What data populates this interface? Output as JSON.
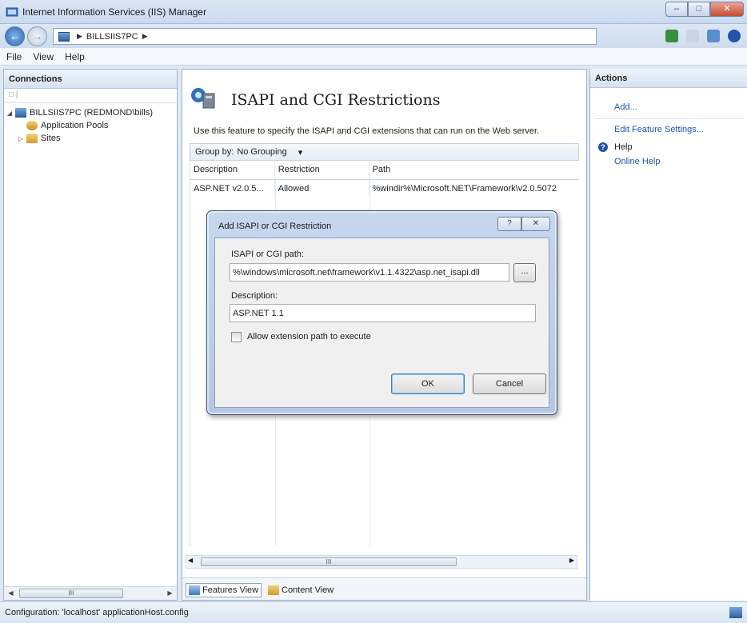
{
  "window": {
    "title": "Internet Information Services (IIS) Manager"
  },
  "address": {
    "segment": "BILLSIIS7PC"
  },
  "menu": [
    "File",
    "View",
    "Help"
  ],
  "connections": {
    "header": "Connections",
    "tree": [
      {
        "label": "BILLSIIS7PC (REDMOND\\bills)"
      },
      {
        "label": "Application Pools"
      },
      {
        "label": "Sites"
      }
    ],
    "scroll_thumb": "III"
  },
  "feature": {
    "title": "ISAPI and CGI Restrictions",
    "description": "Use this feature to specify the ISAPI and CGI extensions that can run on the Web server.",
    "group_by_label": "Group by:",
    "group_by_value": "No Grouping",
    "columns": [
      "Description",
      "Restriction",
      "Path"
    ],
    "rows": [
      {
        "description": "ASP.NET v2.0.5...",
        "restriction": "Allowed",
        "path": "%windir%\\Microsoft.NET\\Framework\\v2.0.5072"
      }
    ],
    "scroll_thumb": "III",
    "tabs": {
      "features_view": "Features View",
      "content_view": "Content View"
    }
  },
  "actions": {
    "header": "Actions",
    "add": "Add...",
    "edit_feature_settings": "Edit Feature Settings...",
    "help_header": "Help",
    "online_help": "Online Help"
  },
  "dialog": {
    "title": "Add ISAPI or CGI Restriction",
    "path_label": "ISAPI or CGI path:",
    "path_value": "%\\windows\\microsoft.net\\framework\\v1.1.4322\\asp.net_isapi.dll",
    "browse_label": "...",
    "description_label": "Description:",
    "description_value": "ASP.NET 1.1",
    "checkbox_label": "Allow extension path to execute",
    "checkbox_checked": false,
    "ok": "OK",
    "cancel": "Cancel",
    "help_btn": "?",
    "close_btn": "✕"
  },
  "status": {
    "text": "Configuration: 'localhost' applicationHost.config"
  }
}
